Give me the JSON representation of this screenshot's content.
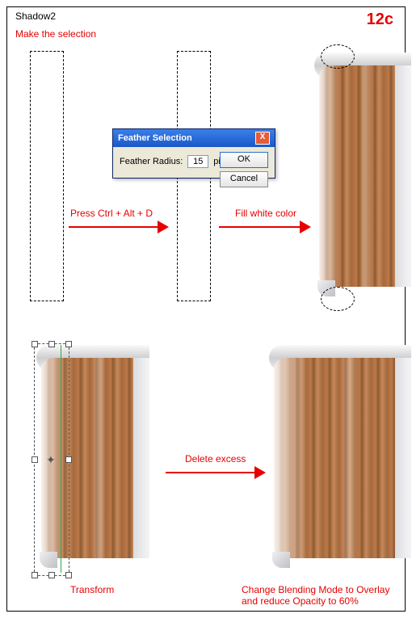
{
  "header": {
    "layer": "Shadow2",
    "step": "12c"
  },
  "labels": {
    "makeSelection": "Make the selection",
    "pressKeys": "Press Ctrl + Alt + D",
    "fillWhite": "Fill white color",
    "transform": "Transform",
    "deleteExcess": "Delete excess",
    "blend": "Change Blending Mode to Overlay\nand reduce Opacity to 60%"
  },
  "dialog": {
    "title": "Feather Selection",
    "fieldLabel": "Feather Radius:",
    "value": "15",
    "units": "pixels",
    "ok": "OK",
    "cancel": "Cancel",
    "closeGlyph": "X"
  },
  "icons": {
    "arrow": "➔"
  }
}
